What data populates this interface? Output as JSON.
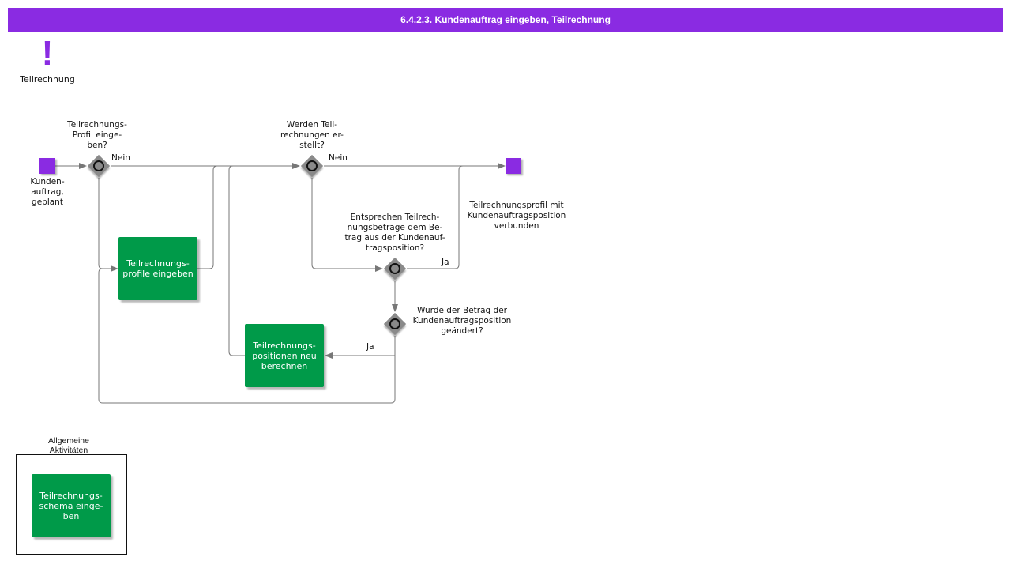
{
  "header": {
    "title": "6.4.2.3. Kundenauftrag eingeben, Teilrechnung"
  },
  "legend": {
    "icon": "exclamation-icon",
    "glyph": "!",
    "label": "Teilrechnung"
  },
  "colors": {
    "header": "#8a2be2",
    "event": "#8a2be2",
    "task": "#009a49",
    "gateway": "#8a8a8a",
    "flow": "#777777"
  },
  "events": {
    "start_label": "Kunden-\nauftrag,\ngeplant",
    "end_label": "Teilrechnungsprofil mit\nKundenauftragsposition\nverbunden"
  },
  "gateways": {
    "g1": {
      "question": "Teilrechnungs-\nProfil einge-\nben?",
      "no_label": "Nein"
    },
    "g2": {
      "question": "Werden Teil-\nrechnungen er-\nstellt?",
      "no_label": "Nein"
    },
    "g3": {
      "question": "Entsprechen Teilrech-\nnungsbeträge dem Be-\ntrag aus der Kundenauf-\ntragsposition?",
      "yes_label": "Ja"
    },
    "g4": {
      "question": "Wurde der Betrag der\nKundenauftragsposition\ngeändert?",
      "yes_label": "Ja"
    }
  },
  "tasks": {
    "profile": "Teilrechnungs-\nprofile eingeben",
    "recalc": "Teilrechnungs-\npositionen neu\nberechnen",
    "schema": "Teilrechnungs-\nschema einge-\nben"
  },
  "group": {
    "label": "Allgemeine\nAktivitäten"
  }
}
